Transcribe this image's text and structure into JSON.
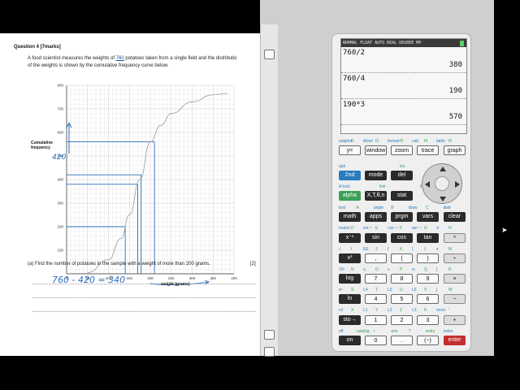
{
  "document": {
    "question_title": "Question 4 [7marks]",
    "intro_pre": "A food scientist measures the weights of ",
    "intro_num": "760",
    "intro_post": " potatoes taken from a single field and the distributio",
    "intro_line2": "of the weights is shown by the cumulative frequency curve below.",
    "part_a": "(a) Find the number of potatoes in the sample with a weight of more than 200 grams.",
    "part_a_marks": "[2]",
    "handwritten_answer": "760 - 420 = 340",
    "handwritten_420": "420"
  },
  "chart_data": {
    "type": "line",
    "ylabel": "Cumulative frequency",
    "xlabel": "weight (grams)",
    "xlim": [
      0,
      400
    ],
    "ylim": [
      0,
      800
    ],
    "xticks": [
      "0",
      "50",
      "100",
      "150",
      "200",
      "250",
      "300",
      "350",
      "400"
    ],
    "yticks": [
      "100",
      "200",
      "300",
      "400",
      "500",
      "600",
      "700",
      "800"
    ],
    "grid": true,
    "series": [
      {
        "name": "",
        "x": [
          50,
          100,
          130,
          150,
          175,
          200,
          225,
          250,
          300,
          350,
          385
        ],
        "y": [
          5,
          60,
          150,
          250,
          400,
          560,
          630,
          680,
          730,
          760,
          765
        ]
      }
    ],
    "annotations": [
      {
        "y": 200,
        "x": 140
      },
      {
        "y": 380,
        "x": 170
      },
      {
        "y": 420,
        "x": 178
      },
      {
        "y": 560,
        "x": 210
      }
    ],
    "colors": {
      "curve": "#999999",
      "annotation": "#2a6ebd"
    }
  },
  "calculator": {
    "status": "NORMAL FLOAT AUTO REAL DEGREE MP",
    "history": [
      {
        "expr": "760/2",
        "result": "380"
      },
      {
        "expr": "760/4",
        "result": "190"
      },
      {
        "expr": "190*3",
        "result": "570"
      }
    ],
    "row1_labels": [
      "statplot",
      "f1",
      "tblset",
      "f2",
      "format",
      "f3",
      "calc",
      "f4",
      "table",
      "f5"
    ],
    "row1_keys": [
      "y=",
      "window",
      "zoom",
      "trace",
      "graph"
    ],
    "row2_labels": [
      "quit",
      "ins"
    ],
    "row2_keys": [
      "2nd",
      "mode",
      "del"
    ],
    "row3_labels": [
      "A-lock",
      "link",
      "list"
    ],
    "row3_keys": [
      "alpha",
      "X,T,θ,n",
      "stat"
    ],
    "row4_labels": [
      "test",
      "A",
      "angle",
      "B",
      "draw",
      "C",
      "distr"
    ],
    "row4_keys": [
      "math",
      "apps",
      "prgm",
      "vars",
      "clear"
    ],
    "row5_labels": [
      "matrix",
      "D",
      "sin⁻¹",
      "E",
      "cos⁻¹",
      "F",
      "tan⁻¹",
      "G",
      "π",
      "H"
    ],
    "row5_keys": [
      "x⁻¹",
      "sin",
      "cos",
      "tan",
      "^"
    ],
    "row6_labels": [
      "√",
      "I",
      "EE",
      "J",
      "{",
      "K",
      "}",
      "L",
      "e",
      "M"
    ],
    "row6_keys": [
      "x²",
      ",",
      "(",
      ")",
      "÷"
    ],
    "row7_labels": [
      "10ˣ",
      "N",
      "u",
      "O",
      "v",
      "P",
      "w",
      "Q",
      "[",
      "R"
    ],
    "row7_keys": [
      "log",
      "7",
      "8",
      "9",
      "×"
    ],
    "row8_labels": [
      "eˣ",
      "S",
      "L4",
      "T",
      "L5",
      "U",
      "L6",
      "V",
      "]",
      "W"
    ],
    "row8_keys": [
      "ln",
      "4",
      "5",
      "6",
      "−"
    ],
    "row9_labels": [
      "rcl",
      "X",
      "L1",
      "Y",
      "L2",
      "Z",
      "L3",
      "θ",
      "mem",
      "\""
    ],
    "row9_keys": [
      "sto→",
      "1",
      "2",
      "3",
      "+"
    ],
    "row10_labels": [
      "off",
      "catalog",
      "i",
      "ans",
      "?",
      "entry",
      "solve"
    ],
    "row10_keys": [
      "on",
      "0",
      ".",
      "(−)",
      "enter"
    ]
  }
}
